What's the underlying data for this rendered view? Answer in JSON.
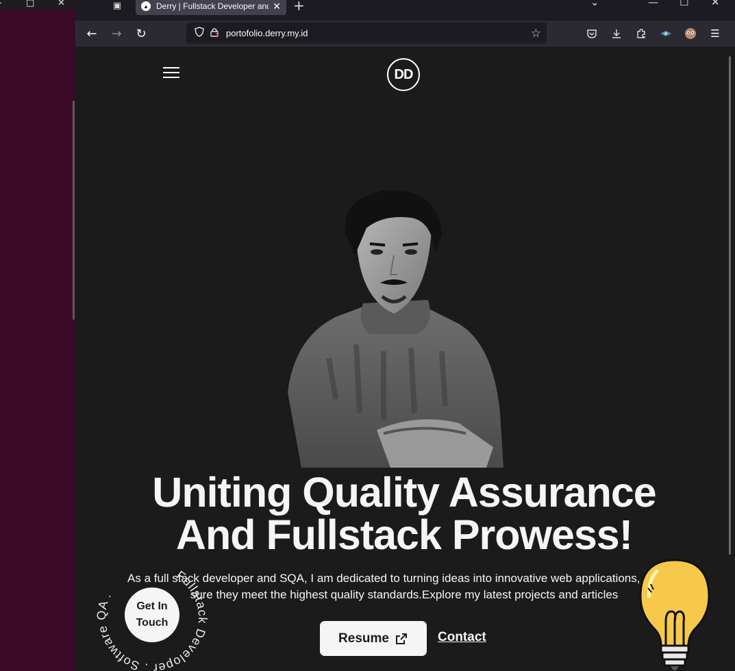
{
  "desktop": {
    "controls": [
      "-",
      "□",
      "✕"
    ]
  },
  "browser": {
    "tab_list_icon": "▣",
    "tab_favicon": "▲",
    "tab_title": "Derry | Fullstack Developer and",
    "tab_close": "✕",
    "new_tab": "+",
    "window_controls": {
      "list": "⌄",
      "minimize": "—",
      "maximize": "☐",
      "close": "✕"
    },
    "nav": {
      "back": "←",
      "forward": "→",
      "reload": "↻"
    },
    "url": "portofolio.derry.my.id",
    "toolbar_icons": [
      "pocket-icon",
      "download-icon",
      "extensions-icon",
      "extension-blue-icon",
      "profile-icon",
      "menu-icon"
    ]
  },
  "site": {
    "logo": "DD",
    "headline_line1": "Uniting Quality Assurance",
    "headline_line2": "And Fullstack Prowess!",
    "intro": "As a full stack developer and SQA, I am dedicated to turning ideas into innovative web applications, making sure they meet the highest quality standards.Explore my latest projects and articles",
    "resume_label": "Resume",
    "contact_label": "Contact",
    "get_in_touch_line1": "Get In",
    "get_in_touch_line2": "Touch",
    "rotating_text": "Fullstack Developer . Software QA . "
  }
}
